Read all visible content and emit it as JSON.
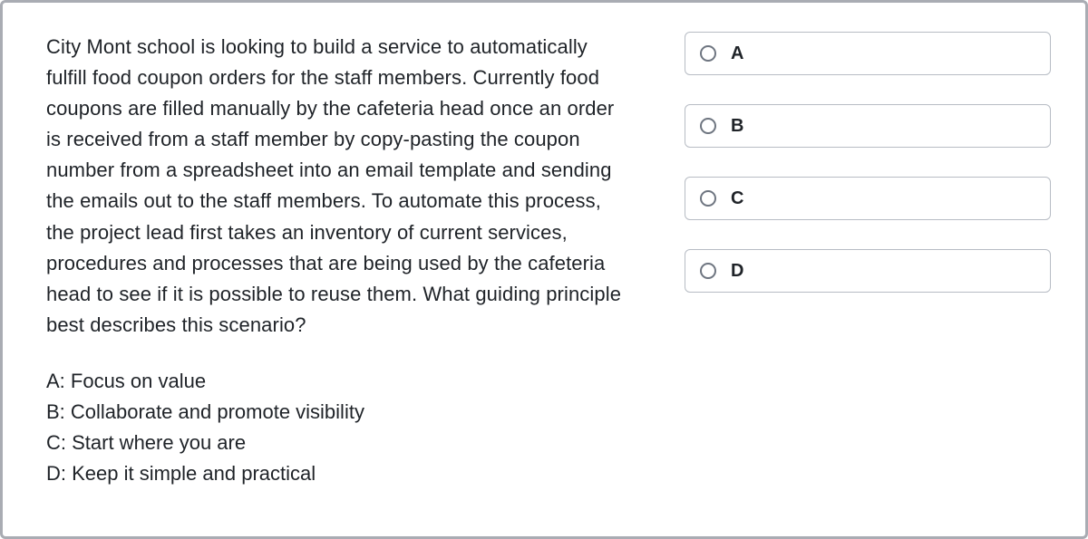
{
  "question": "City Mont school is looking to build a service to automatically fulfill food coupon orders for the staff members. Currently food coupons are filled manually by the cafeteria head once an order is received from a staff member by copy-pasting the coupon number from a spreadsheet into an email template and sending the emails out to the staff members. To automate this process, the project lead first takes an inventory of current services, procedures and processes that are being used by the cafeteria head to see if it is possible to reuse them. What guiding principle best describes this scenario?",
  "choices": {
    "a": "A: Focus on value",
    "b": "B: Collaborate and promote visibility",
    "c": "C: Start where you are",
    "d": "D: Keep it simple and practical"
  },
  "options": {
    "a": "A",
    "b": "B",
    "c": "C",
    "d": "D"
  }
}
